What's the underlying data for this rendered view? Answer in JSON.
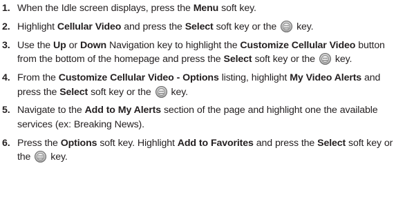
{
  "steps": [
    {
      "number": "1.",
      "parts": [
        {
          "t": "When the Idle screen displays, press the "
        },
        {
          "t": "Menu",
          "b": true
        },
        {
          "t": " soft key."
        }
      ]
    },
    {
      "number": "2.",
      "parts": [
        {
          "t": "Highlight "
        },
        {
          "t": "Cellular Video",
          "b": true
        },
        {
          "t": " and press the "
        },
        {
          "t": "Select",
          "b": true
        },
        {
          "t": " soft key or the "
        },
        {
          "icon": "ok-key-icon"
        },
        {
          "t": " key."
        }
      ]
    },
    {
      "number": "3.",
      "parts": [
        {
          "t": "Use the "
        },
        {
          "t": "Up",
          "b": true
        },
        {
          "t": " or "
        },
        {
          "t": "Down",
          "b": true
        },
        {
          "t": " Navigation key to highlight the "
        },
        {
          "t": "Customize Cellular Video",
          "b": true
        },
        {
          "t": " button from the bottom of the homepage and press the "
        },
        {
          "t": "Select",
          "b": true
        },
        {
          "t": " soft key or the "
        },
        {
          "icon": "ok-key-icon"
        },
        {
          "t": " key."
        }
      ]
    },
    {
      "number": "4.",
      "parts": [
        {
          "t": "From the "
        },
        {
          "t": "Customize Cellular Video - Options",
          "b": true
        },
        {
          "t": " listing, highlight "
        },
        {
          "t": "My Video Alerts",
          "b": true
        },
        {
          "t": " and press the "
        },
        {
          "t": "Select",
          "b": true
        },
        {
          "t": " soft key or the "
        },
        {
          "icon": "ok-key-icon"
        },
        {
          "t": " key."
        }
      ]
    },
    {
      "number": "5.",
      "parts": [
        {
          "t": "Navigate to the "
        },
        {
          "t": "Add to My Alerts",
          "b": true
        },
        {
          "t": " section of the page and highlight one the available services (ex: Breaking News)."
        }
      ]
    },
    {
      "number": "6.",
      "parts": [
        {
          "t": "Press the "
        },
        {
          "t": "Options",
          "b": true
        },
        {
          "t": " soft key. Highlight "
        },
        {
          "t": "Add to Favorites",
          "b": true
        },
        {
          "t": " and press the "
        },
        {
          "t": "Select",
          "b": true
        },
        {
          "t": " soft key or the "
        },
        {
          "icon": "ok-key-icon"
        },
        {
          "t": " key."
        }
      ]
    }
  ]
}
